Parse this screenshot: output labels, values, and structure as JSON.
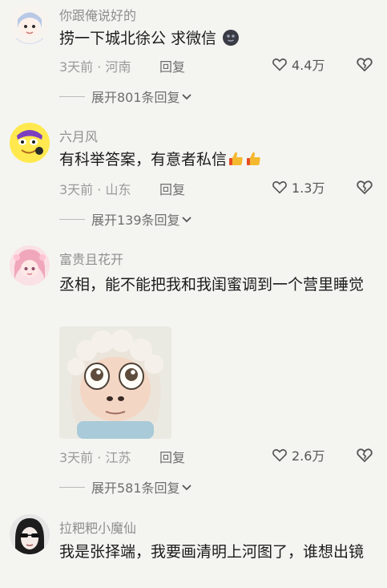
{
  "colors": {
    "background": "#f4f5f1",
    "username": "#8e8e8e",
    "text": "#1b1b1b",
    "meta": "#9a9a9a"
  },
  "comments": [
    {
      "username": "你跟俺说好的",
      "text": "捞一下城北徐公 求微信 ",
      "inline_icon": "face-emoji-icon",
      "time": "3天前",
      "location": "河南",
      "reply_label": "回复",
      "likes": "4.4万",
      "expand": "展开801条回复"
    },
    {
      "username": "六月风",
      "text": "有科举答案，有意者私信",
      "inline_icon": "thumbs-up-icon",
      "time": "3天前",
      "location": "山东",
      "reply_label": "回复",
      "likes": "1.3万",
      "expand": "展开139条回复"
    },
    {
      "username": "富贵且花开",
      "text": "丞相，能不能把我和我闺蜜调到一个营里睡觉",
      "sticker": "lamb-face-sticker",
      "time": "3天前",
      "location": "江苏",
      "reply_label": "回复",
      "likes": "2.6万",
      "expand": "展开581条回复"
    },
    {
      "username": "拉粑粑小魔仙",
      "text": "我是张择端，我要画清明上河图了，谁想出镜"
    }
  ]
}
